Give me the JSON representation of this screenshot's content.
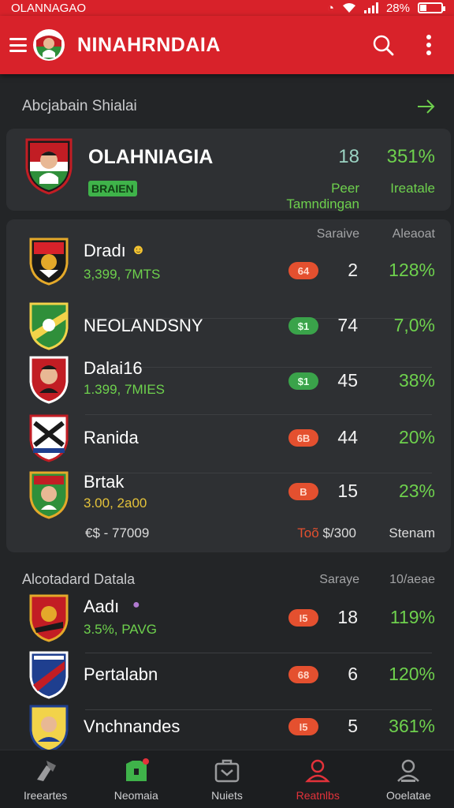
{
  "status_bar": {
    "carrier": "OLANNAGAO",
    "battery_text": "28%",
    "battery_level": 0.28
  },
  "app_bar": {
    "title": "NINAHRNDAIA"
  },
  "featured": {
    "section_title": "Abcjabain Shialai",
    "team": "OLAHNIAGIA",
    "badge": "BRAIEN",
    "score": "18",
    "percent": "351%",
    "label_left": "Peer Tamndingan",
    "label_right": "Ireatale"
  },
  "list1": {
    "col_score": "Saraive",
    "col_percent": "Aleaoat",
    "rows": [
      {
        "name": "Dradı",
        "sub": "3,399, 7MTS",
        "sub_color": "green",
        "pill": "64",
        "pill_color": "red",
        "score": "2",
        "percent": "128%",
        "emoji": true
      },
      {
        "name": "NEOLANDSNY",
        "sub": "",
        "pill": "$1",
        "pill_color": "green",
        "score": "74",
        "percent": "7,0%"
      },
      {
        "name": "Dalai16",
        "sub": "1.399, 7MIES",
        "sub_color": "green",
        "pill": "$1",
        "pill_color": "green",
        "score": "45",
        "percent": "38%"
      },
      {
        "name": "Ranida",
        "sub": "",
        "pill": "6B",
        "pill_color": "red",
        "score": "44",
        "percent": "20%"
      },
      {
        "name": "Brtak",
        "sub": "3.00, 2a00",
        "sub_color": "yellow",
        "pill": "B",
        "pill_color": "red",
        "score": "15",
        "percent": "23%"
      }
    ],
    "footer": {
      "left": "€$ - 77009",
      "mid_red": "Toõ",
      "mid": "$/300",
      "right": "Stenam"
    }
  },
  "list2": {
    "section_title": "Alcotadard Datala",
    "col_score": "Saraye",
    "col_percent": "10/aeae",
    "rows": [
      {
        "name": "Aadı",
        "sub": "3.5%, PAVG",
        "sub_color": "green",
        "pill": "I5",
        "pill_color": "red",
        "score": "18",
        "percent": "119%",
        "emoji": true
      },
      {
        "name": "Pertalabn",
        "sub": "",
        "pill": "68",
        "pill_color": "red",
        "score": "6",
        "percent": "120%"
      },
      {
        "name": "Vnchnandes",
        "sub": "",
        "pill": "I5",
        "pill_color": "red",
        "score": "5",
        "percent": "361%"
      }
    ]
  },
  "bottom_nav": [
    {
      "label": "Ireeartes",
      "icon": "tools-icon",
      "active": false
    },
    {
      "label": "Neomaia",
      "icon": "football-shirt-icon",
      "active": false
    },
    {
      "label": "Nuiets",
      "icon": "briefcase-icon",
      "active": false
    },
    {
      "label": "Reatnlbs",
      "icon": "person-icon",
      "active": true
    },
    {
      "label": "Ooelatae",
      "icon": "profile-icon",
      "active": false
    }
  ],
  "colors": {
    "primary": "#d8222a",
    "positive": "#6ed14d",
    "background": "#232527",
    "card": "#2e3033"
  }
}
